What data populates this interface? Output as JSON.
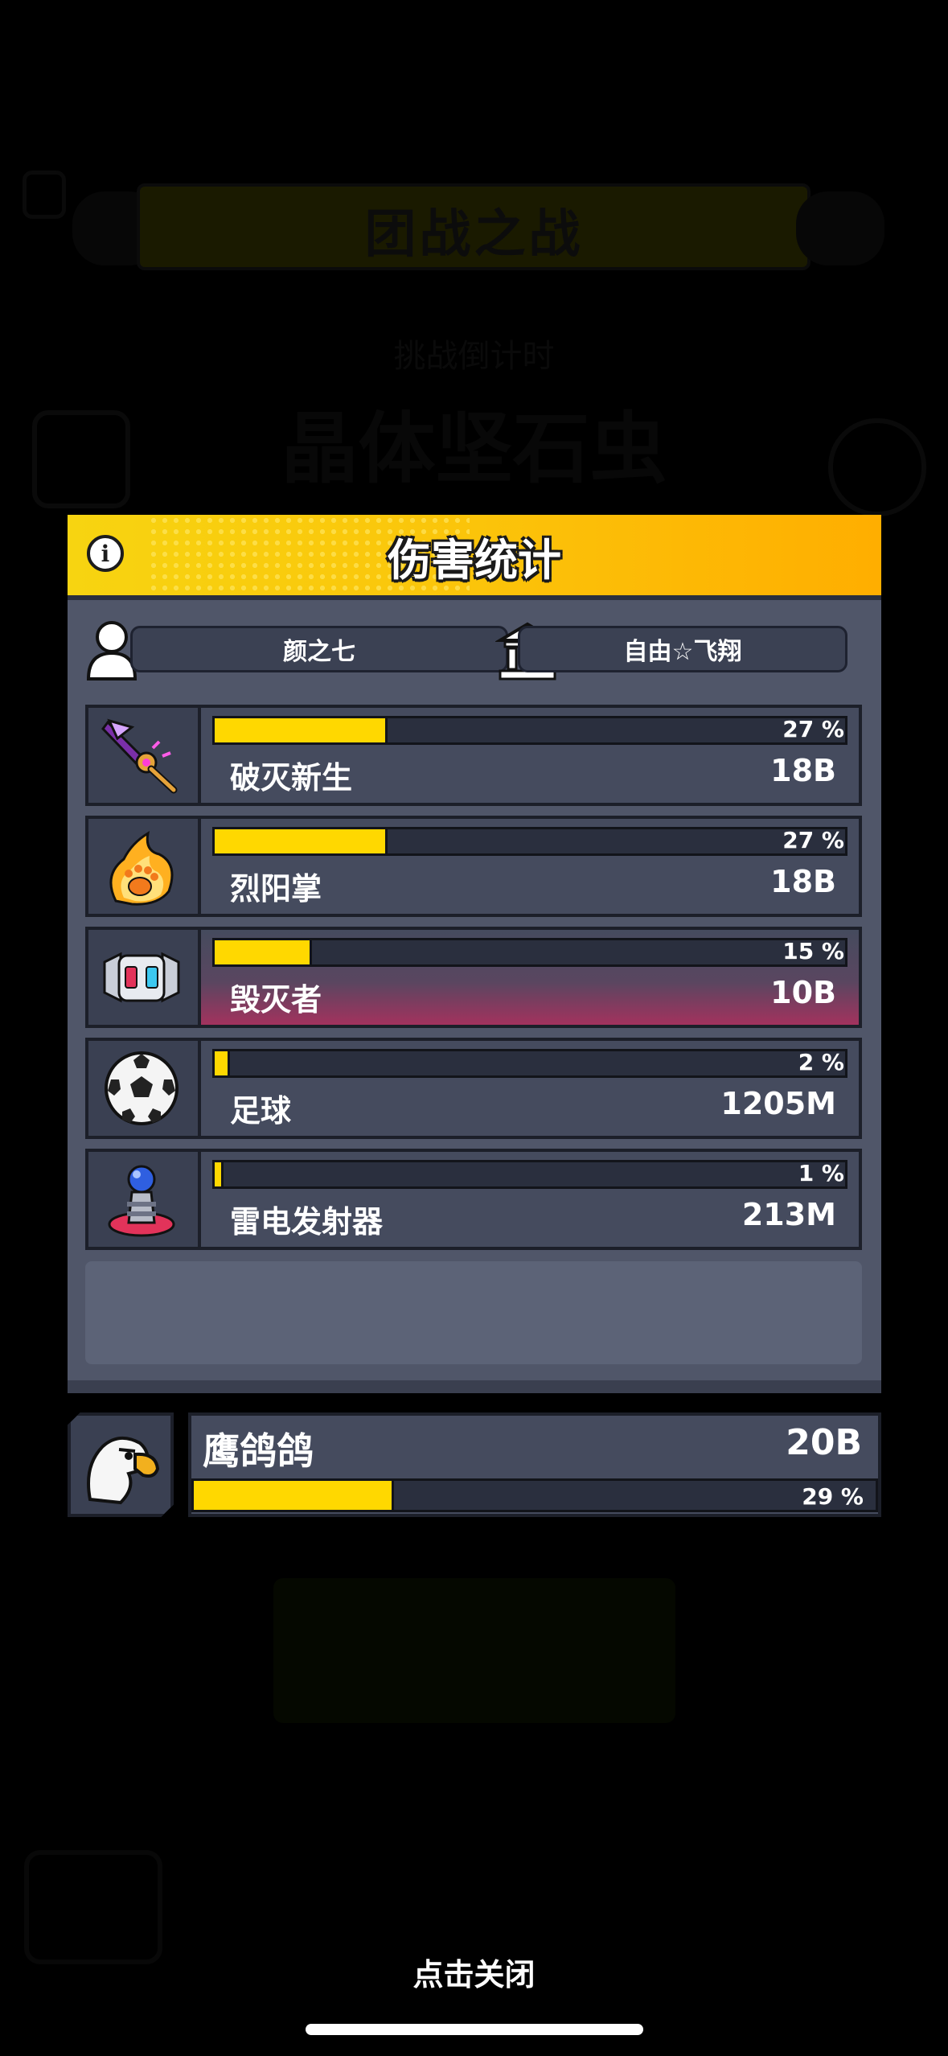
{
  "background": {
    "title": "团战之战",
    "subtitle": "挑战倒计时",
    "headline": "晶体坚石虫"
  },
  "modal": {
    "title": "伤害统计",
    "player_name": "颜之七",
    "guild_name": "自由☆飞翔",
    "info_icon": "info-icon",
    "rows": [
      {
        "name": "破灭新生",
        "percent_label": "27 %",
        "fraction": 0.27,
        "damage": "18B",
        "icon": "purple-axe-icon",
        "highlight": false
      },
      {
        "name": "烈阳掌",
        "percent_label": "27 %",
        "fraction": 0.27,
        "damage": "18B",
        "icon": "flaming-paw-icon",
        "highlight": false
      },
      {
        "name": "毁灭者",
        "percent_label": "15 %",
        "fraction": 0.15,
        "damage": "10B",
        "icon": "robot-drone-icon",
        "highlight": true
      },
      {
        "name": "足球",
        "percent_label": "2 %",
        "fraction": 0.02,
        "damage": "1205M",
        "icon": "soccer-ball-icon",
        "highlight": false
      },
      {
        "name": "雷电发射器",
        "percent_label": "1 %",
        "fraction": 0.01,
        "damage": "213M",
        "icon": "tesla-emitter-icon",
        "highlight": false
      }
    ]
  },
  "pet": {
    "name": "鹰鸽鸽",
    "damage": "20B",
    "percent_label": "29 %",
    "fraction": 0.29,
    "icon": "eagle-icon"
  },
  "close_hint": "点击关闭",
  "colors": {
    "bar_fill": "#ffd800",
    "header_yellow": "#fbc40a",
    "panel": "#505669"
  }
}
